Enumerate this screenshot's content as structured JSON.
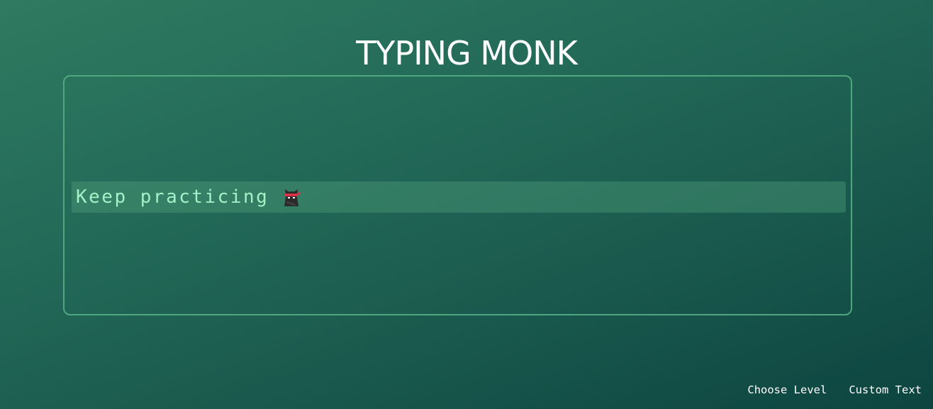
{
  "app": {
    "title": "TYPING MONK"
  },
  "typing_area": {
    "current_line": "Keep practicing",
    "emoji": "ninja-icon"
  },
  "footer": {
    "choose_level_label": "Choose Level",
    "custom_text_label": "Custom Text"
  },
  "colors": {
    "background_start": "#2f7a60",
    "background_end": "#0d4440",
    "box_border": "#4fa67f",
    "text_accent": "#a6f0c9"
  }
}
